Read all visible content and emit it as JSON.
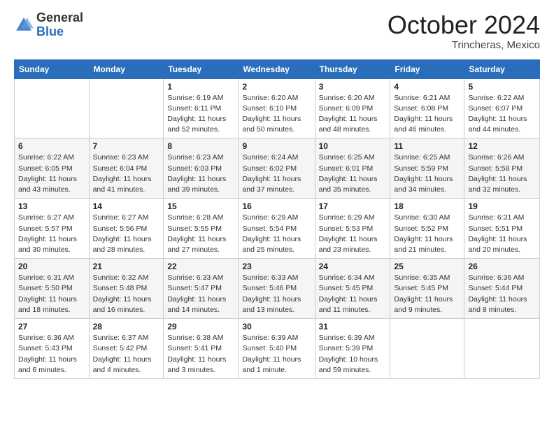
{
  "header": {
    "logo_general": "General",
    "logo_blue": "Blue",
    "month": "October 2024",
    "location": "Trincheras, Mexico"
  },
  "days_of_week": [
    "Sunday",
    "Monday",
    "Tuesday",
    "Wednesday",
    "Thursday",
    "Friday",
    "Saturday"
  ],
  "weeks": [
    [
      {
        "day": "",
        "sunrise": "",
        "sunset": "",
        "daylight": ""
      },
      {
        "day": "",
        "sunrise": "",
        "sunset": "",
        "daylight": ""
      },
      {
        "day": "1",
        "sunrise": "Sunrise: 6:19 AM",
        "sunset": "Sunset: 6:11 PM",
        "daylight": "Daylight: 11 hours and 52 minutes."
      },
      {
        "day": "2",
        "sunrise": "Sunrise: 6:20 AM",
        "sunset": "Sunset: 6:10 PM",
        "daylight": "Daylight: 11 hours and 50 minutes."
      },
      {
        "day": "3",
        "sunrise": "Sunrise: 6:20 AM",
        "sunset": "Sunset: 6:09 PM",
        "daylight": "Daylight: 11 hours and 48 minutes."
      },
      {
        "day": "4",
        "sunrise": "Sunrise: 6:21 AM",
        "sunset": "Sunset: 6:08 PM",
        "daylight": "Daylight: 11 hours and 46 minutes."
      },
      {
        "day": "5",
        "sunrise": "Sunrise: 6:22 AM",
        "sunset": "Sunset: 6:07 PM",
        "daylight": "Daylight: 11 hours and 44 minutes."
      }
    ],
    [
      {
        "day": "6",
        "sunrise": "Sunrise: 6:22 AM",
        "sunset": "Sunset: 6:05 PM",
        "daylight": "Daylight: 11 hours and 43 minutes."
      },
      {
        "day": "7",
        "sunrise": "Sunrise: 6:23 AM",
        "sunset": "Sunset: 6:04 PM",
        "daylight": "Daylight: 11 hours and 41 minutes."
      },
      {
        "day": "8",
        "sunrise": "Sunrise: 6:23 AM",
        "sunset": "Sunset: 6:03 PM",
        "daylight": "Daylight: 11 hours and 39 minutes."
      },
      {
        "day": "9",
        "sunrise": "Sunrise: 6:24 AM",
        "sunset": "Sunset: 6:02 PM",
        "daylight": "Daylight: 11 hours and 37 minutes."
      },
      {
        "day": "10",
        "sunrise": "Sunrise: 6:25 AM",
        "sunset": "Sunset: 6:01 PM",
        "daylight": "Daylight: 11 hours and 35 minutes."
      },
      {
        "day": "11",
        "sunrise": "Sunrise: 6:25 AM",
        "sunset": "Sunset: 5:59 PM",
        "daylight": "Daylight: 11 hours and 34 minutes."
      },
      {
        "day": "12",
        "sunrise": "Sunrise: 6:26 AM",
        "sunset": "Sunset: 5:58 PM",
        "daylight": "Daylight: 11 hours and 32 minutes."
      }
    ],
    [
      {
        "day": "13",
        "sunrise": "Sunrise: 6:27 AM",
        "sunset": "Sunset: 5:57 PM",
        "daylight": "Daylight: 11 hours and 30 minutes."
      },
      {
        "day": "14",
        "sunrise": "Sunrise: 6:27 AM",
        "sunset": "Sunset: 5:56 PM",
        "daylight": "Daylight: 11 hours and 28 minutes."
      },
      {
        "day": "15",
        "sunrise": "Sunrise: 6:28 AM",
        "sunset": "Sunset: 5:55 PM",
        "daylight": "Daylight: 11 hours and 27 minutes."
      },
      {
        "day": "16",
        "sunrise": "Sunrise: 6:29 AM",
        "sunset": "Sunset: 5:54 PM",
        "daylight": "Daylight: 11 hours and 25 minutes."
      },
      {
        "day": "17",
        "sunrise": "Sunrise: 6:29 AM",
        "sunset": "Sunset: 5:53 PM",
        "daylight": "Daylight: 11 hours and 23 minutes."
      },
      {
        "day": "18",
        "sunrise": "Sunrise: 6:30 AM",
        "sunset": "Sunset: 5:52 PM",
        "daylight": "Daylight: 11 hours and 21 minutes."
      },
      {
        "day": "19",
        "sunrise": "Sunrise: 6:31 AM",
        "sunset": "Sunset: 5:51 PM",
        "daylight": "Daylight: 11 hours and 20 minutes."
      }
    ],
    [
      {
        "day": "20",
        "sunrise": "Sunrise: 6:31 AM",
        "sunset": "Sunset: 5:50 PM",
        "daylight": "Daylight: 11 hours and 18 minutes."
      },
      {
        "day": "21",
        "sunrise": "Sunrise: 6:32 AM",
        "sunset": "Sunset: 5:48 PM",
        "daylight": "Daylight: 11 hours and 16 minutes."
      },
      {
        "day": "22",
        "sunrise": "Sunrise: 6:33 AM",
        "sunset": "Sunset: 5:47 PM",
        "daylight": "Daylight: 11 hours and 14 minutes."
      },
      {
        "day": "23",
        "sunrise": "Sunrise: 6:33 AM",
        "sunset": "Sunset: 5:46 PM",
        "daylight": "Daylight: 11 hours and 13 minutes."
      },
      {
        "day": "24",
        "sunrise": "Sunrise: 6:34 AM",
        "sunset": "Sunset: 5:45 PM",
        "daylight": "Daylight: 11 hours and 11 minutes."
      },
      {
        "day": "25",
        "sunrise": "Sunrise: 6:35 AM",
        "sunset": "Sunset: 5:45 PM",
        "daylight": "Daylight: 11 hours and 9 minutes."
      },
      {
        "day": "26",
        "sunrise": "Sunrise: 6:36 AM",
        "sunset": "Sunset: 5:44 PM",
        "daylight": "Daylight: 11 hours and 8 minutes."
      }
    ],
    [
      {
        "day": "27",
        "sunrise": "Sunrise: 6:36 AM",
        "sunset": "Sunset: 5:43 PM",
        "daylight": "Daylight: 11 hours and 6 minutes."
      },
      {
        "day": "28",
        "sunrise": "Sunrise: 6:37 AM",
        "sunset": "Sunset: 5:42 PM",
        "daylight": "Daylight: 11 hours and 4 minutes."
      },
      {
        "day": "29",
        "sunrise": "Sunrise: 6:38 AM",
        "sunset": "Sunset: 5:41 PM",
        "daylight": "Daylight: 11 hours and 3 minutes."
      },
      {
        "day": "30",
        "sunrise": "Sunrise: 6:39 AM",
        "sunset": "Sunset: 5:40 PM",
        "daylight": "Daylight: 11 hours and 1 minute."
      },
      {
        "day": "31",
        "sunrise": "Sunrise: 6:39 AM",
        "sunset": "Sunset: 5:39 PM",
        "daylight": "Daylight: 10 hours and 59 minutes."
      },
      {
        "day": "",
        "sunrise": "",
        "sunset": "",
        "daylight": ""
      },
      {
        "day": "",
        "sunrise": "",
        "sunset": "",
        "daylight": ""
      }
    ]
  ]
}
